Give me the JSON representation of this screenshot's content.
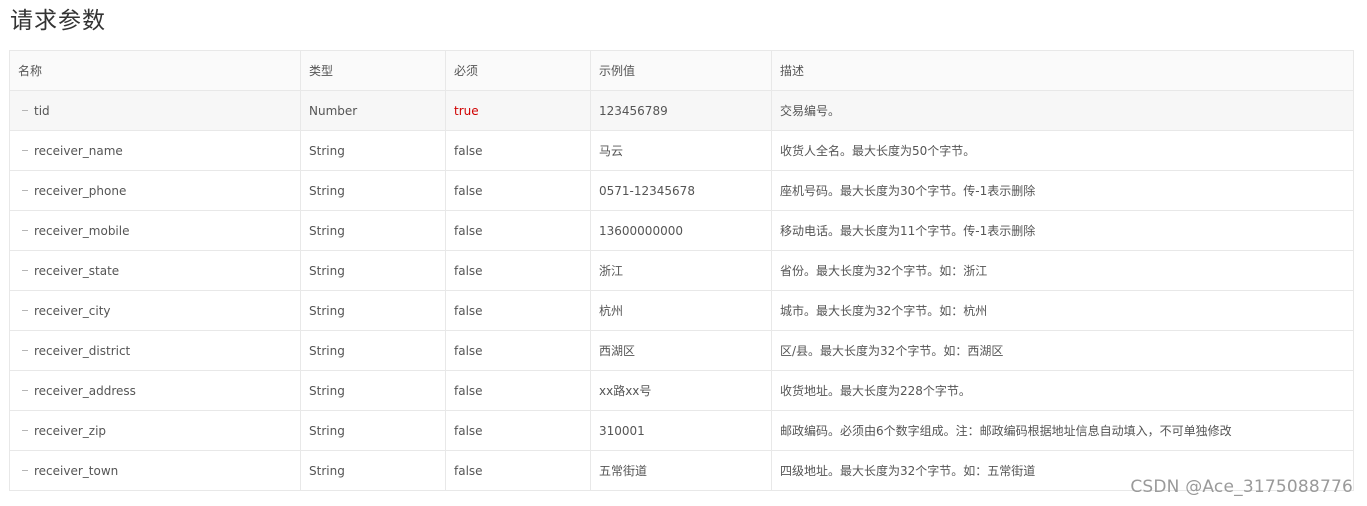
{
  "page": {
    "title": "请求参数"
  },
  "table": {
    "headers": [
      "名称",
      "类型",
      "必须",
      "示例值",
      "描述"
    ],
    "rows": [
      {
        "name": "tid",
        "type": "Number",
        "required": "true",
        "example": "123456789",
        "desc": "交易编号。"
      },
      {
        "name": "receiver_name",
        "type": "String",
        "required": "false",
        "example": "马云",
        "desc": "收货人全名。最大长度为50个字节。"
      },
      {
        "name": "receiver_phone",
        "type": "String",
        "required": "false",
        "example": "0571-12345678",
        "desc": "座机号码。最大长度为30个字节。传-1表示删除"
      },
      {
        "name": "receiver_mobile",
        "type": "String",
        "required": "false",
        "example": "13600000000",
        "desc": "移动电话。最大长度为11个字节。传-1表示删除"
      },
      {
        "name": "receiver_state",
        "type": "String",
        "required": "false",
        "example": "浙江",
        "desc": "省份。最大长度为32个字节。如：浙江"
      },
      {
        "name": "receiver_city",
        "type": "String",
        "required": "false",
        "example": "杭州",
        "desc": "城市。最大长度为32个字节。如：杭州"
      },
      {
        "name": "receiver_district",
        "type": "String",
        "required": "false",
        "example": "西湖区",
        "desc": "区/县。最大长度为32个字节。如：西湖区"
      },
      {
        "name": "receiver_address",
        "type": "String",
        "required": "false",
        "example": "xx路xx号",
        "desc": "收货地址。最大长度为228个字节。"
      },
      {
        "name": "receiver_zip",
        "type": "String",
        "required": "false",
        "example": "310001",
        "desc": "邮政编码。必须由6个数字组成。注：邮政编码根据地址信息自动填入，不可单独修改"
      },
      {
        "name": "receiver_town",
        "type": "String",
        "required": "false",
        "example": "五常街道",
        "desc": "四级地址。最大长度为32个字节。如：五常街道"
      }
    ]
  },
  "watermark": "CSDN @Ace_3175088776",
  "colors": {
    "required_true": "#d00000",
    "border": "#e8e8e8",
    "header_bg": "#fafafa"
  }
}
